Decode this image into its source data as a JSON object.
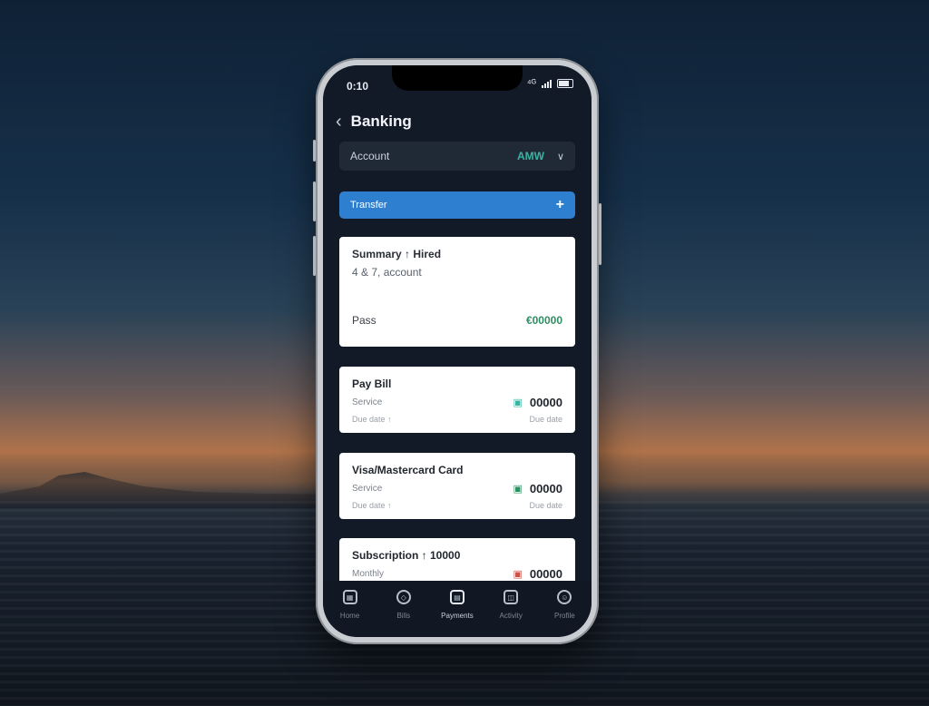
{
  "status": {
    "time": "0:10",
    "network": "⁴ᴳ"
  },
  "header": {
    "title": "Banking"
  },
  "account": {
    "label": "Account",
    "value": "AMW"
  },
  "add_bar": {
    "label": "Transfer"
  },
  "cards": {
    "summary": {
      "title": "Summary ↑ Hired",
      "sub": "4 & 7, account",
      "foot_left": "Pass",
      "foot_amount": "€00000"
    },
    "pay_bill": {
      "title": "Pay Bill",
      "left": "Service",
      "amount": "00000",
      "note_left": "Due date ↑",
      "note_right": "Due date"
    },
    "card_payment": {
      "title": "Visa/Mastercard Card",
      "left": "Service",
      "amount": "00000",
      "note_left": "Due date ↑",
      "note_right": "Due date"
    },
    "subscription": {
      "title": "Subscription ↑ 10000",
      "left": "Monthly",
      "amount": "00000"
    }
  },
  "tabs": [
    {
      "label": "Home"
    },
    {
      "label": "Bills"
    },
    {
      "label": "Payments"
    },
    {
      "label": "Activity"
    },
    {
      "label": "Profile"
    }
  ],
  "colors": {
    "accent": "#2f7fd0",
    "positive": "#2f8f62",
    "teal": "#3ab3a0",
    "negative": "#c9524a"
  }
}
